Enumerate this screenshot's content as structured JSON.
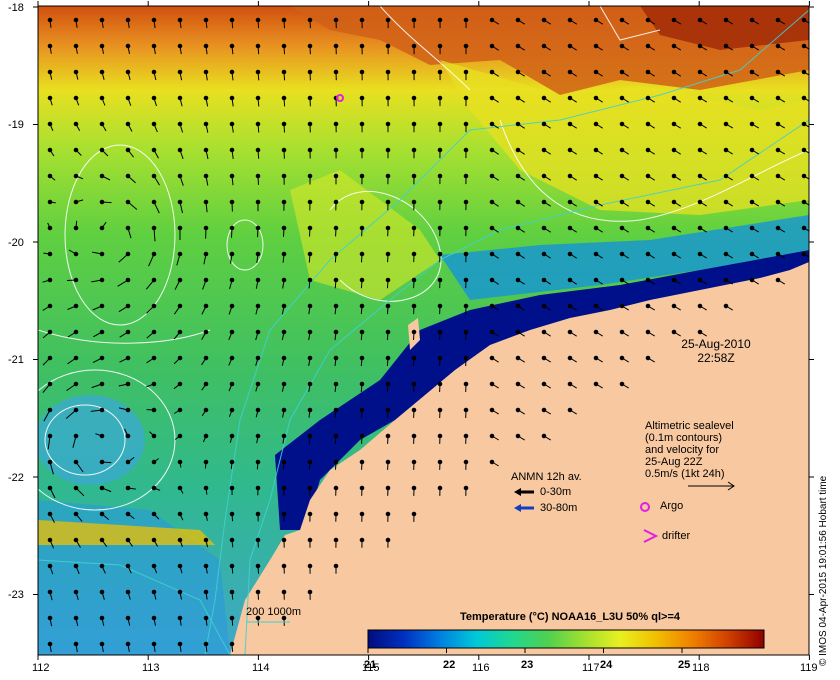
{
  "map": {
    "x_ticks": [
      "112",
      "113",
      "114",
      "115",
      "116",
      "117",
      "118",
      "119"
    ],
    "y_ticks": [
      "-18",
      "-19",
      "-20",
      "-21",
      "-22",
      "-23"
    ],
    "lon_range": [
      112,
      119
    ],
    "lat_range": [
      -23.5,
      -17.8
    ]
  },
  "timestamp": {
    "date": "25-Aug-2010",
    "time": "22:58Z"
  },
  "altimetry_note": {
    "line1": "Altimetric sealevel",
    "line2": "(0.1m contours)",
    "line3": "and velocity for",
    "line4": "25-Aug 22Z",
    "scale": "0.5m/s (1kt 24h)"
  },
  "anmn": {
    "title": "ANMN 12h av.",
    "shallow_label": "0-30m",
    "deep_label": "30-80m",
    "shallow_color": "#000000",
    "deep_color": "#1040c0"
  },
  "markers": {
    "argo_label": "Argo",
    "drifter_label": "drifter",
    "marker_color": "#e020e0"
  },
  "bathymetry": {
    "label": "200  1000m",
    "color": "#40d0d0"
  },
  "colorbar": {
    "title": "Temperature (°C) NOAA16_L3U 50% ql>=4",
    "tick_labels": [
      "21",
      "22",
      "23",
      "24",
      "25"
    ],
    "range": [
      21,
      25.8
    ],
    "colors": [
      "#000d80",
      "#0030c0",
      "#0080e0",
      "#00c8d8",
      "#20d890",
      "#50d050",
      "#a0e030",
      "#e8f020",
      "#f0c000",
      "#f08000",
      "#d04000",
      "#900000"
    ]
  },
  "land_color": "#f8c8a0",
  "credit": "© IMOS 04-Apr-2015 19:01:56 Hobart time"
}
